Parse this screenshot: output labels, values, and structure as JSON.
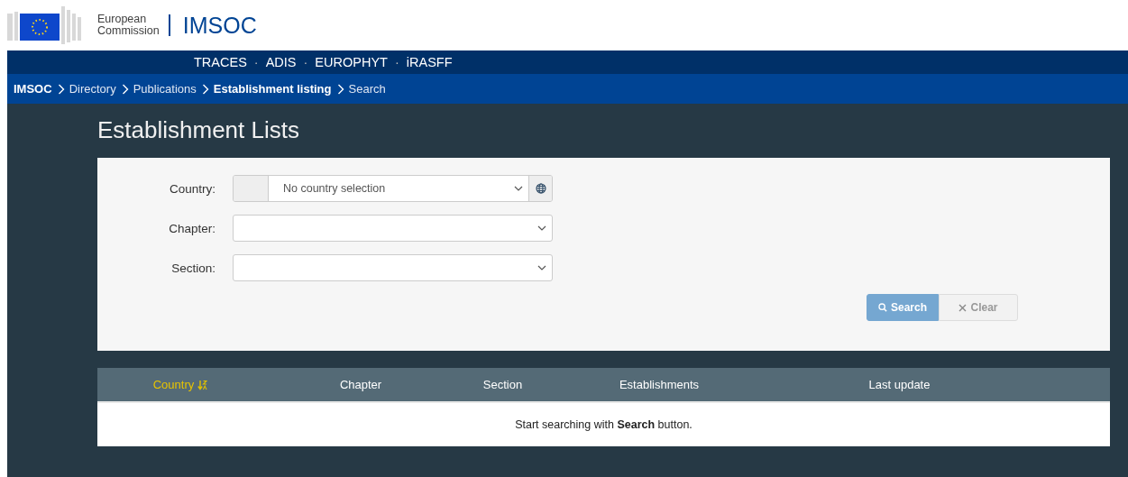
{
  "header": {
    "org_line1": "European",
    "org_line2": "Commission",
    "app_name": "IMSOC"
  },
  "systems": [
    {
      "label": "TRACES",
      "kind": "link"
    },
    {
      "label": "·",
      "kind": "separator"
    },
    {
      "label": "ADIS",
      "kind": "link"
    },
    {
      "label": "·",
      "kind": "separator"
    },
    {
      "label": "EUROPHYT",
      "kind": "link"
    },
    {
      "label": "·",
      "kind": "separator"
    },
    {
      "label": "iRASFF",
      "kind": "link"
    }
  ],
  "breadcrumb": [
    {
      "label": "IMSOC",
      "bold": true
    },
    {
      "label": "Directory",
      "bold": false
    },
    {
      "label": "Publications",
      "bold": false
    },
    {
      "label": "Establishment listing",
      "bold": true
    },
    {
      "label": "Search",
      "bold": false
    }
  ],
  "page_title": "Establishment Lists",
  "form": {
    "fields": [
      {
        "label": "Country:",
        "kind": "country",
        "value": "No country selection"
      },
      {
        "label": "Chapter:",
        "kind": "select"
      },
      {
        "label": "Section:",
        "kind": "select"
      }
    ],
    "buttons": [
      {
        "label": "Search",
        "kind": "primary",
        "disabled": true
      },
      {
        "label": "Clear",
        "kind": "secondary",
        "disabled": true
      }
    ]
  },
  "table": {
    "columns": [
      {
        "label": "Country",
        "sorted": true
      },
      {
        "label": "Chapter",
        "sorted": false
      },
      {
        "label": "Section",
        "sorted": false
      },
      {
        "label": "Establishments",
        "sorted": false
      },
      {
        "label": "Last update",
        "sorted": false
      }
    ],
    "empty_message": "Start searching with **Search** button."
  }
}
